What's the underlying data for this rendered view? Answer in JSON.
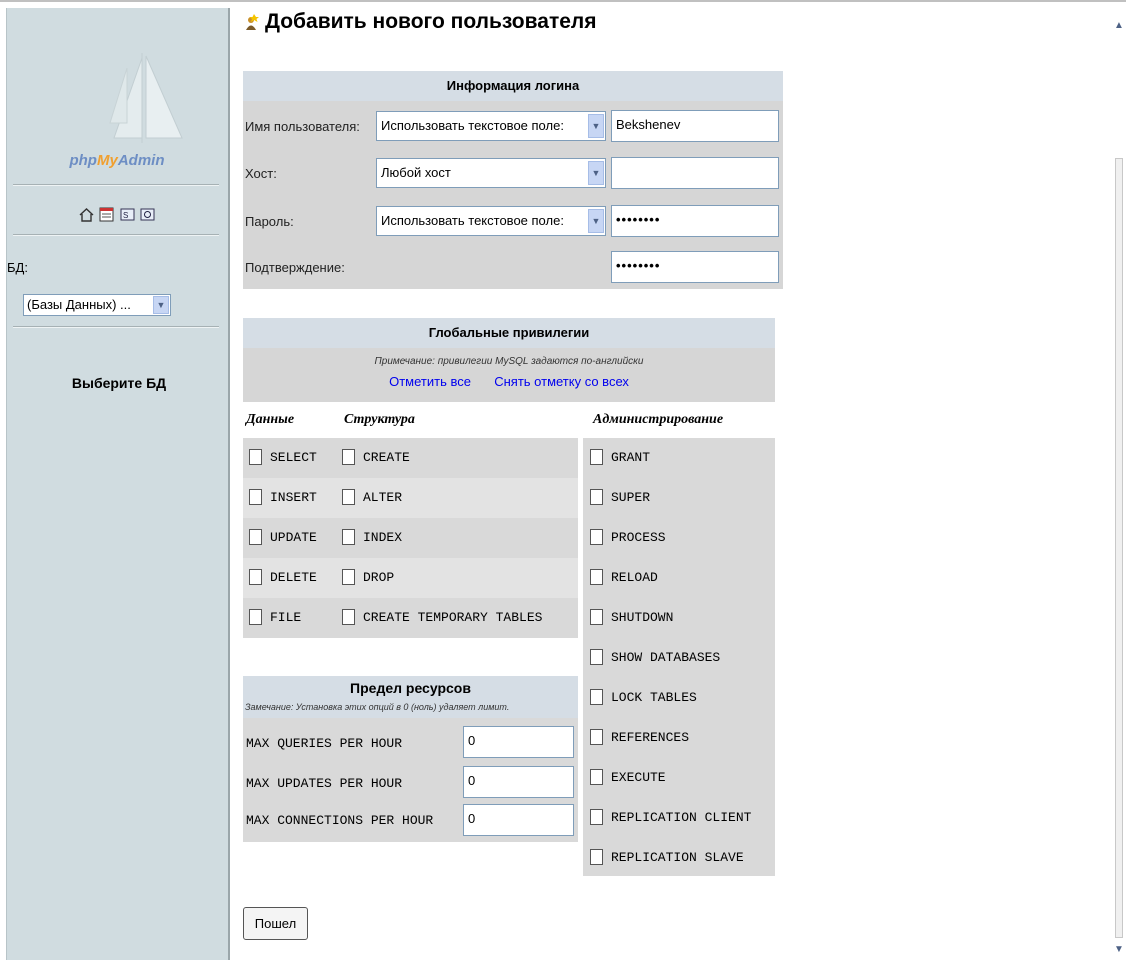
{
  "sidebar": {
    "logo_text_pre": "php",
    "logo_text_my": "My",
    "logo_text_post": "Admin",
    "db_label": "БД:",
    "db_select_value": "(Базы Данных) ...",
    "choose_db": "Выберите БД",
    "icons": [
      "home-icon",
      "query-window-icon",
      "sql-docs-icon",
      "phpmyadmin-docs-icon"
    ]
  },
  "page": {
    "title": "Добавить нового пользователя"
  },
  "login_info": {
    "header": "Информация логина",
    "username_label": "Имя пользователя:",
    "username_type": "Использовать текстовое поле:",
    "username_value": "Bekshenev",
    "host_label": "Хост:",
    "host_type": "Любой хост",
    "host_value": "",
    "password_label": "Пароль:",
    "password_type": "Использовать текстовое поле:",
    "password_value": "••••••••",
    "confirm_label": "Подтверждение:",
    "confirm_value": "••••••••"
  },
  "global_privileges": {
    "header": "Глобальные привилегии",
    "note": "Примечание: привилегии MySQL задаются по-английски",
    "check_all": "Отметить все",
    "uncheck_all": "Снять отметку со всех",
    "col_data": "Данные",
    "col_structure": "Структура",
    "col_admin": "Администрирование",
    "data": [
      "SELECT",
      "INSERT",
      "UPDATE",
      "DELETE",
      "FILE"
    ],
    "structure": [
      "CREATE",
      "ALTER",
      "INDEX",
      "DROP",
      "CREATE TEMPORARY TABLES"
    ],
    "admin": [
      "GRANT",
      "SUPER",
      "PROCESS",
      "RELOAD",
      "SHUTDOWN",
      "SHOW DATABASES",
      "LOCK TABLES",
      "REFERENCES",
      "EXECUTE",
      "REPLICATION CLIENT",
      "REPLICATION SLAVE"
    ]
  },
  "resource_limits": {
    "header": "Предел ресурсов",
    "note": "Замечание: Установка этих опций в 0 (ноль) удаляет лимит.",
    "rows": [
      {
        "label": "MAX QUERIES PER HOUR",
        "value": "0"
      },
      {
        "label": "MAX UPDATES PER HOUR",
        "value": "0"
      },
      {
        "label": "MAX CONNECTIONS PER HOUR",
        "value": "0"
      }
    ]
  },
  "actions": {
    "go_label": "Пошел"
  },
  "colors": {
    "sidebar_bg": "#d0dce0",
    "header_bg": "#d5dde5",
    "row_bg": "#d6d6d6",
    "link": "#0000ee"
  }
}
